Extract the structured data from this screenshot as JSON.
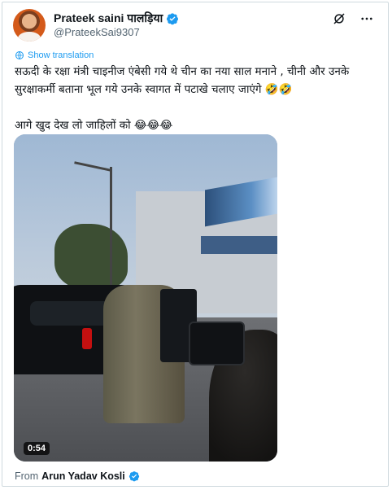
{
  "post": {
    "author_name": "Prateek saini पालड़िया",
    "handle": "@PrateekSai9307",
    "translate_label": "Show translation",
    "text": "सऊदी के रक्षा मंत्री चाइनीज एंबेसी गये थे चीन का नया साल मनाने , चीनी और उनके\nसुरक्षाकर्मी बताना भूल गये उनके स्वागत में पटाखे चलाए जाएंगे 🤣🤣\n\nआगे खुद देख लो जाहिलों को 😂😂😂",
    "media": {
      "duration": "0:54"
    },
    "from_label": "From",
    "from_name": "Arun Yadav Kosli"
  },
  "icons": {
    "verified": "verified-badge-icon",
    "grok": "grok-icon",
    "more": "more-icon",
    "translate": "translate-icon"
  },
  "colors": {
    "accent": "#1d9bf0",
    "muted": "#536471",
    "text": "#0f1419"
  }
}
